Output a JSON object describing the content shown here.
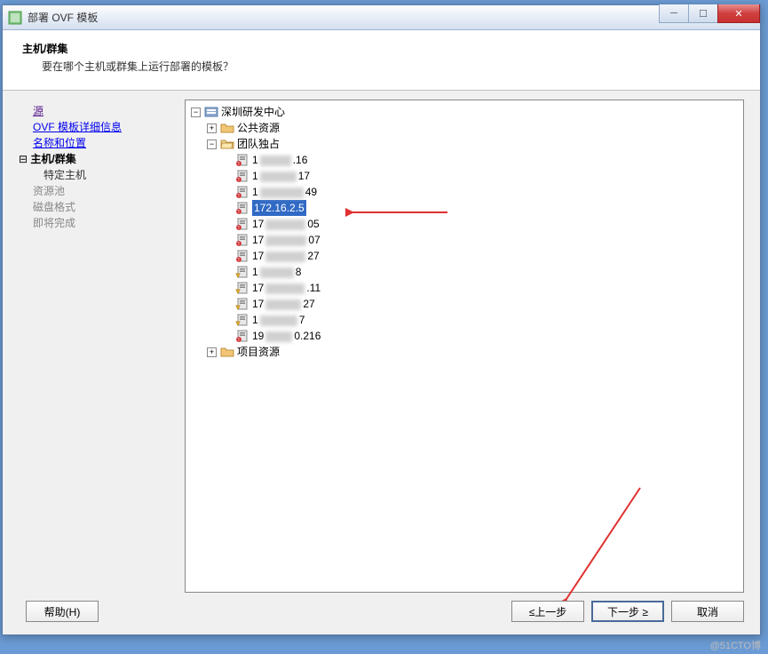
{
  "window": {
    "title": "部署 OVF 模板"
  },
  "header": {
    "title": "主机/群集",
    "subtitle": "要在哪个主机或群集上运行部署的模板？"
  },
  "nav": {
    "items": [
      {
        "label": "源",
        "type": "visited"
      },
      {
        "label": "OVF 模板详细信息",
        "type": "link"
      },
      {
        "label": "名称和位置",
        "type": "link"
      },
      {
        "label": "主机/群集",
        "type": "current"
      },
      {
        "label": "特定主机",
        "type": "sub"
      },
      {
        "label": "资源池",
        "type": "disabled"
      },
      {
        "label": "磁盘格式",
        "type": "disabled"
      },
      {
        "label": "即将完成",
        "type": "disabled"
      }
    ]
  },
  "tree": {
    "root": {
      "label": "深圳研发中心",
      "icon": "datacenter",
      "exp": "-"
    },
    "folders": [
      {
        "label": "公共资源",
        "icon": "folder",
        "exp": "+"
      },
      {
        "label": "团队独占",
        "icon": "folder-open",
        "exp": "-"
      }
    ],
    "hosts": [
      {
        "pre": "1",
        "mid": "XXX",
        "post": ".16",
        "warn": true
      },
      {
        "pre": "1",
        "mid": "XXX",
        "post": "17",
        "warn": true
      },
      {
        "pre": "1",
        "mid": "XXX",
        "post": "49",
        "warn": true
      },
      {
        "pre": "172.16.2.5",
        "mid": "",
        "post": "",
        "warn": true,
        "selected": true
      },
      {
        "pre": "17",
        "mid": "XXX",
        "post": "05",
        "warn": true
      },
      {
        "pre": "17",
        "mid": "XXX",
        "post": "07",
        "warn": true
      },
      {
        "pre": "17",
        "mid": "XXX",
        "post": "27",
        "warn": true
      },
      {
        "pre": "1",
        "mid": "XXX",
        "post": "8",
        "warn": false
      },
      {
        "pre": "17",
        "mid": "XXX",
        "post": ".11",
        "warn": false
      },
      {
        "pre": "17",
        "mid": "XXX",
        "post": "27",
        "warn": false
      },
      {
        "pre": "1",
        "mid": "XXX",
        "post": "7",
        "warn": false
      },
      {
        "pre": "19",
        "mid": "XXX",
        "post": "0.216",
        "warn": true
      }
    ],
    "folder_after": {
      "label": "项目资源",
      "icon": "folder",
      "exp": "+"
    }
  },
  "buttons": {
    "help": "帮助(H)",
    "back": "≤上一步",
    "next": "下一步 ≥",
    "cancel": "取消"
  },
  "watermark": "@51CTO博"
}
